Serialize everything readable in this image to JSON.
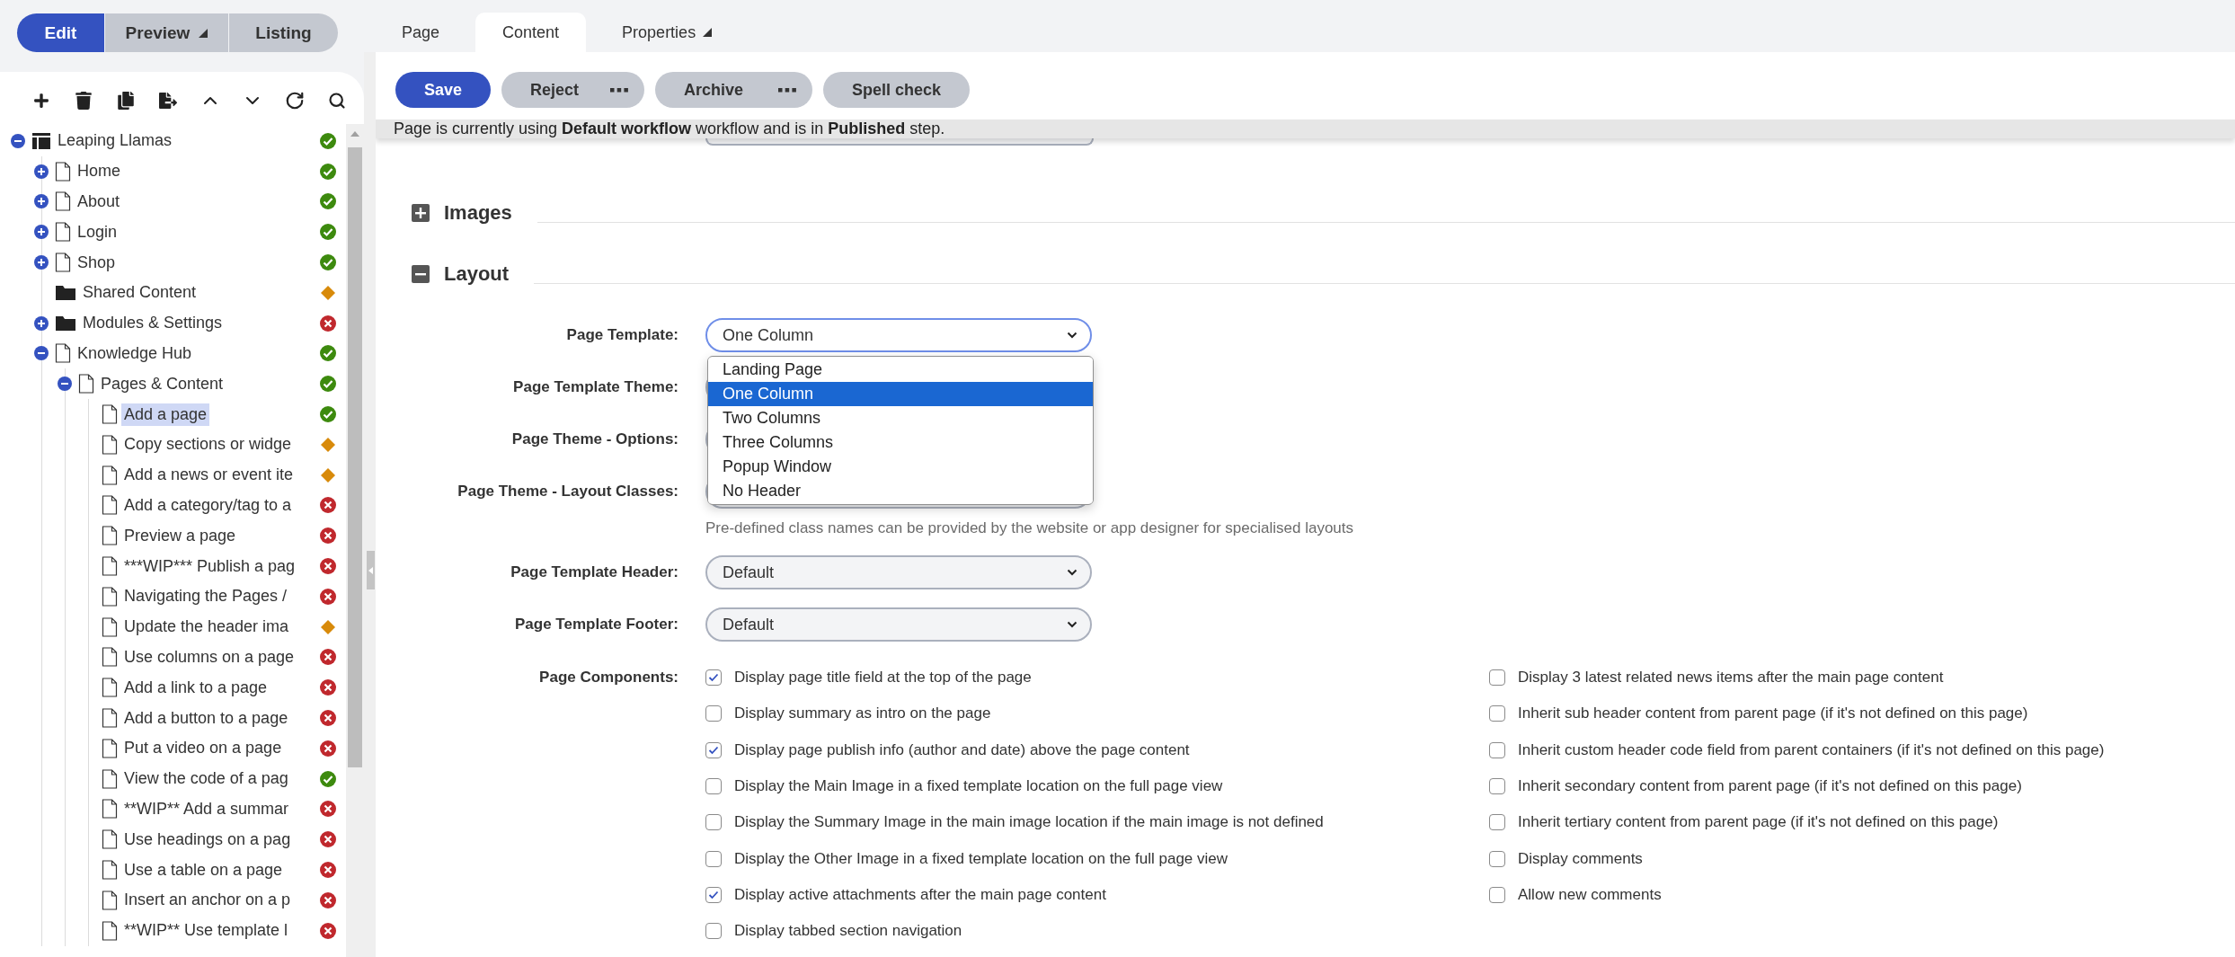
{
  "mode_buttons": [
    {
      "label": "Edit",
      "selected": true,
      "menu": false
    },
    {
      "label": "Preview",
      "selected": false,
      "menu": true
    },
    {
      "label": "Listing",
      "selected": false,
      "menu": false
    }
  ],
  "tabs": [
    {
      "label": "Page",
      "selected": false,
      "menu": false
    },
    {
      "label": "Content",
      "selected": true,
      "menu": false
    },
    {
      "label": "Properties",
      "selected": false,
      "menu": true
    }
  ],
  "tree": [
    {
      "label": "Leaping Llamas",
      "kind": "site",
      "color": "#3d8a0e",
      "selected": false,
      "expanded": true,
      "children": [
        {
          "label": "Home",
          "kind": "page",
          "color": "#3d8a0e",
          "selected": false,
          "expanded": false
        },
        {
          "label": "About",
          "kind": "page",
          "color": "#3d8a0e",
          "selected": false,
          "expanded": false
        },
        {
          "label": "Login",
          "kind": "page",
          "color": "#3d8a0e",
          "selected": false,
          "expanded": false
        },
        {
          "label": "Shop",
          "kind": "page",
          "color": "#3d8a0e",
          "selected": false,
          "expanded": false
        },
        {
          "label": "Shared Content",
          "kind": "folder",
          "color": "#d88a0a",
          "selected": false
        },
        {
          "label": "Modules & Settings",
          "kind": "folder",
          "color": "#c0282d",
          "selected": false,
          "expanded": false
        },
        {
          "label": "Knowledge Hub",
          "kind": "page",
          "color": "#3d8a0e",
          "selected": false,
          "expanded": true,
          "children": [
            {
              "label": "Pages & Content",
              "kind": "page",
              "color": "#3d8a0e",
              "selected": false,
              "expanded": true,
              "children": [
                {
                  "label": "Add a page",
                  "kind": "page",
                  "color": "#3d8a0e",
                  "selected": true
                },
                {
                  "label": "Copy sections or widge",
                  "kind": "page",
                  "color": "#d88a0a",
                  "selected": false
                },
                {
                  "label": "Add a news or event ite",
                  "kind": "page",
                  "color": "#d88a0a",
                  "selected": false
                },
                {
                  "label": "Add a category/tag to a",
                  "kind": "page",
                  "color": "#c0282d",
                  "selected": false
                },
                {
                  "label": "Preview a page",
                  "kind": "page",
                  "color": "#c0282d",
                  "selected": false
                },
                {
                  "label": "***WIP*** Publish a pag",
                  "kind": "page",
                  "color": "#c0282d",
                  "selected": false
                },
                {
                  "label": "Navigating the Pages /",
                  "kind": "page",
                  "color": "#c0282d",
                  "selected": false
                },
                {
                  "label": "Update the header ima",
                  "kind": "page",
                  "color": "#d88a0a",
                  "selected": false
                },
                {
                  "label": "Use columns on a page",
                  "kind": "page",
                  "color": "#c0282d",
                  "selected": false
                },
                {
                  "label": "Add a link to a page",
                  "kind": "page",
                  "color": "#c0282d",
                  "selected": false
                },
                {
                  "label": "Add a button to a page",
                  "kind": "page",
                  "color": "#c0282d",
                  "selected": false
                },
                {
                  "label": "Put a video on a page",
                  "kind": "page",
                  "color": "#c0282d",
                  "selected": false
                },
                {
                  "label": "View the code of a pag",
                  "kind": "page",
                  "color": "#3d8a0e",
                  "selected": false
                },
                {
                  "label": "**WIP** Add a summar",
                  "kind": "page",
                  "color": "#c0282d",
                  "selected": false
                },
                {
                  "label": "Use headings on a pag",
                  "kind": "page",
                  "color": "#c0282d",
                  "selected": false
                },
                {
                  "label": "Use a table on a page",
                  "kind": "page",
                  "color": "#c0282d",
                  "selected": false
                },
                {
                  "label": "Insert an anchor on a p",
                  "kind": "page",
                  "color": "#c0282d",
                  "selected": false
                },
                {
                  "label": "**WIP** Use template l",
                  "kind": "page",
                  "color": "#c0282d",
                  "selected": false
                }
              ]
            }
          ]
        }
      ]
    }
  ],
  "toolbar": [
    {
      "label": "Save",
      "kind": "primary"
    },
    {
      "label": "Reject",
      "kind": "more"
    },
    {
      "label": "Archive",
      "kind": "more"
    },
    {
      "label": "Spell check",
      "kind": "plain"
    }
  ],
  "status_message": "Page is currently using **Default workflow** workflow and is in **Published** step.",
  "sections": [
    {
      "title": "Images",
      "expanded": false
    },
    {
      "title": "Layout",
      "expanded": true,
      "fields": [
        {
          "label": "Page Template:",
          "value": "One Column",
          "open": true,
          "options": [
            {
              "label": "Landing Page",
              "selected": false
            },
            {
              "label": "One Column",
              "selected": true
            },
            {
              "label": "Two Columns",
              "selected": false
            },
            {
              "label": "Three Columns",
              "selected": false
            },
            {
              "label": "Popup Window",
              "selected": false
            },
            {
              "label": "No Header",
              "selected": false
            }
          ]
        },
        {
          "label": "Page Template Theme:",
          "open": false
        },
        {
          "label": "Page Theme - Options:",
          "open": false
        },
        {
          "label": "Page Theme - Layout Classes:",
          "open": false,
          "hint": "Pre-defined class names can be provided by the website or app designer for specialised layouts"
        },
        {
          "label": "Page Template Header:",
          "value": "Default",
          "open": false
        },
        {
          "label": "Page Template Footer:",
          "value": "Default",
          "open": false
        }
      ],
      "components": {
        "label": "Page Components:",
        "left": [
          {
            "label": "Display page title field at the top of the page",
            "checked": true
          },
          {
            "label": "Display summary as intro on the page",
            "checked": false
          },
          {
            "label": "Display page publish info (author and date) above the page content",
            "checked": true
          },
          {
            "label": "Display the Main Image in a fixed template location on the full page view",
            "checked": false
          },
          {
            "label": "Display the Summary Image in the main image location if the main image is not defined",
            "checked": false
          },
          {
            "label": "Display the Other Image in a fixed template location on the full page view",
            "checked": false
          },
          {
            "label": "Display active attachments after the main page content",
            "checked": true
          },
          {
            "label": "Display tabbed section navigation",
            "checked": false
          }
        ],
        "right": [
          {
            "label": "Display 3 latest related news items after the main page content",
            "checked": false
          },
          {
            "label": "Inherit sub header content from parent page (if it's not defined on this page)",
            "checked": false
          },
          {
            "label": "Inherit custom header code field from parent containers (if it's not defined on this page)",
            "checked": false
          },
          {
            "label": "Inherit secondary content from parent page (if it's not defined on this page)",
            "checked": false
          },
          {
            "label": "Inherit tertiary content from parent page (if it's not defined on this page)",
            "checked": false
          },
          {
            "label": "Display comments",
            "checked": false
          },
          {
            "label": "Allow new comments",
            "checked": false
          }
        ]
      }
    }
  ]
}
